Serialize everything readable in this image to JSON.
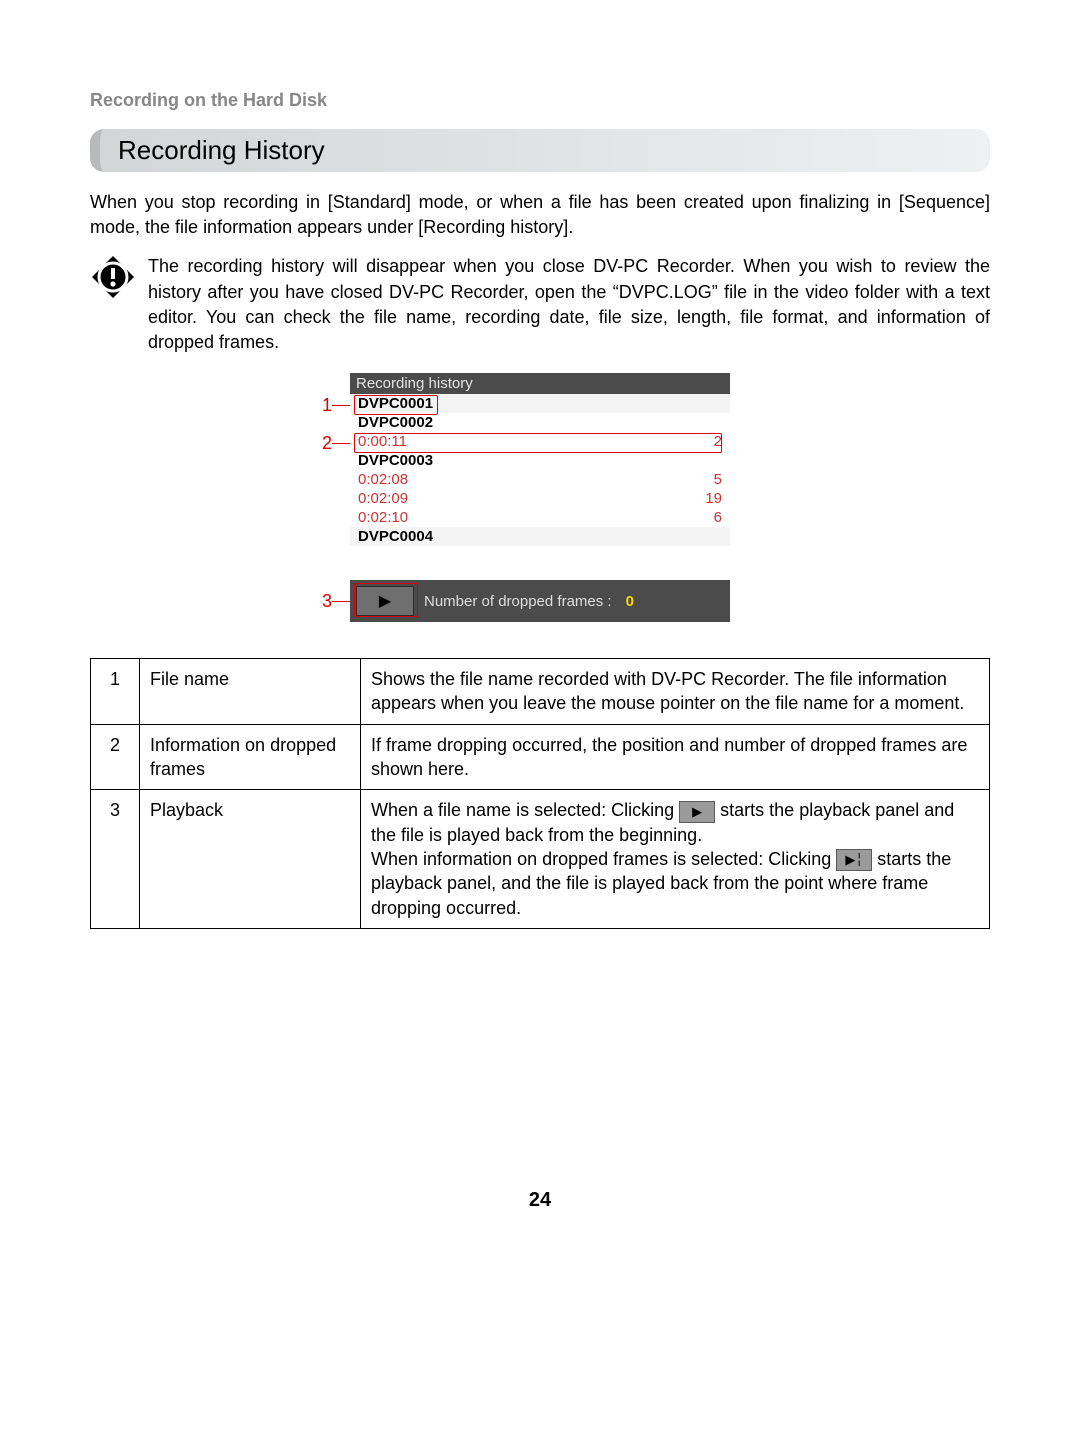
{
  "pre_heading": "Recording on the Hard Disk",
  "section_title": "Recording History",
  "intro": "When you stop recording in [Standard] mode, or when a file has been created upon finalizing in [Sequence] mode, the file information appears under [Recording history].",
  "note": "The recording history will disappear when you close DV-PC Recorder. When you wish to review the history after you have closed DV-PC Recorder, open the “DVPC.LOG” file in the video folder with a text editor. You can check the file name, recording date, file size, length, file format, and information of dropped frames.",
  "screenshot": {
    "title": "Recording history",
    "files": [
      {
        "name": "DVPC0001",
        "drops": []
      },
      {
        "name": "DVPC0002",
        "drops": [
          {
            "time": "0:00:11",
            "count": "2"
          }
        ]
      },
      {
        "name": "DVPC0003",
        "drops": [
          {
            "time": "0:02:08",
            "count": "5"
          },
          {
            "time": "0:02:09",
            "count": "19"
          },
          {
            "time": "0:02:10",
            "count": "6"
          }
        ]
      },
      {
        "name": "DVPC0004",
        "drops": []
      }
    ],
    "footer_label": "Number of dropped frames :",
    "footer_count": "0"
  },
  "callouts": {
    "c1": "1",
    "c2": "2",
    "c3": "3"
  },
  "table": {
    "rows": [
      {
        "num": "1",
        "label": "File name",
        "desc": "Shows the file name recorded with DV-PC Recorder. The file information appears when you leave the mouse pointer on the file name for a moment."
      },
      {
        "num": "2",
        "label": "Information on dropped frames",
        "desc": "If frame dropping occurred, the position and number of dropped frames are shown here."
      },
      {
        "num": "3",
        "label": "Playback",
        "desc_parts": {
          "a": "When a file name is selected: Clicking ",
          "b": " starts the playback panel and the file is played back from the beginning.",
          "c": "When information on dropped frames is selected: Clicking ",
          "d": " starts the playback panel, and the file is played back from the point where frame dropping occurred."
        }
      }
    ]
  },
  "page_number": "24"
}
